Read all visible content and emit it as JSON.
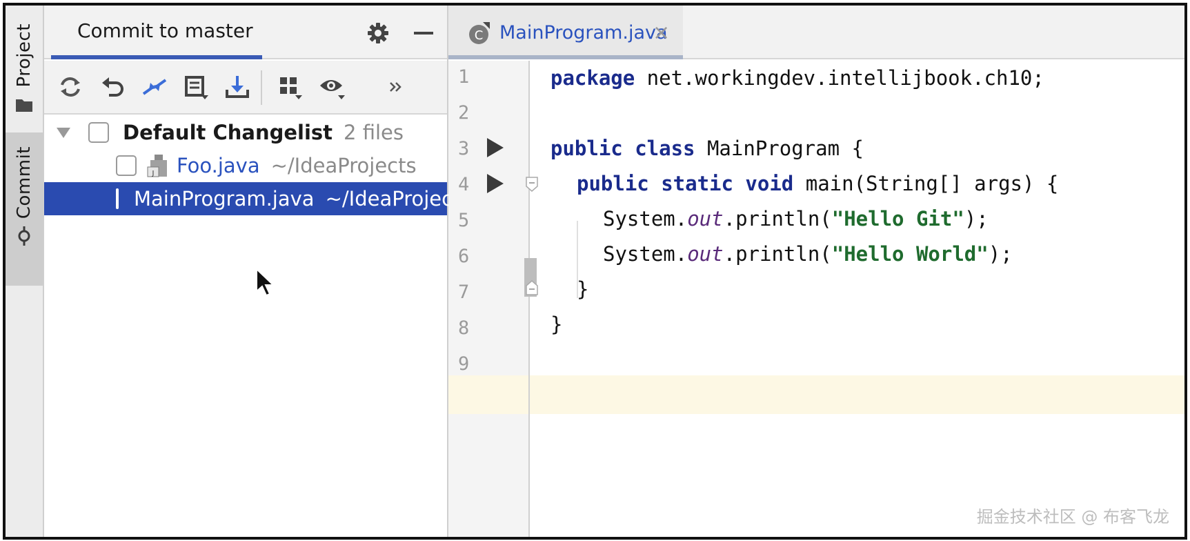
{
  "sidebar": {
    "tabs": [
      {
        "label": "Project"
      },
      {
        "label": "Commit"
      }
    ]
  },
  "commit_panel": {
    "title": "Commit to master",
    "toolbar_icons": [
      "refresh-icon",
      "rollback-icon",
      "compare-icon",
      "shelve-icon",
      "update-icon",
      "group-by-icon",
      "view-options-icon",
      "more-icon"
    ],
    "changelist": {
      "name": "Default Changelist",
      "count": "2 files"
    },
    "files": [
      {
        "name": "Foo.java",
        "path": "~/IdeaProjects",
        "selected": false
      },
      {
        "name": "MainProgram.java",
        "path": "~/IdeaProjects",
        "selected": true
      }
    ]
  },
  "editor": {
    "tab": {
      "label": "MainProgram.java",
      "close": "×"
    },
    "line_numbers": [
      "1",
      "2",
      "3",
      "4",
      "5",
      "6",
      "7",
      "8",
      "9"
    ],
    "code": {
      "l1_kw": "package",
      "l1_rest": " net.workingdev.intellijbook.ch10;",
      "l3_kw": "public class",
      "l3_rest": " MainProgram {",
      "l4_kw": "public static void",
      "l4_rest": " main(String[] args) {",
      "l5_pre": "System.",
      "l5_it": "out",
      "l5_mid": ".println(",
      "l5_str": "\"Hello Git\"",
      "l5_end": ");",
      "l6_pre": "System.",
      "l6_it": "out",
      "l6_mid": ".println(",
      "l6_str": "\"Hello World\"",
      "l6_end": ");",
      "l7": "}",
      "l8": "}"
    }
  },
  "watermark": "掘金技术社区 @ 布客飞龙",
  "colors": {
    "selection": "#2a4bb0",
    "link_blue": "#2a52be",
    "keyword": "#1a2b8c",
    "current_line": "#fdf8e4"
  }
}
